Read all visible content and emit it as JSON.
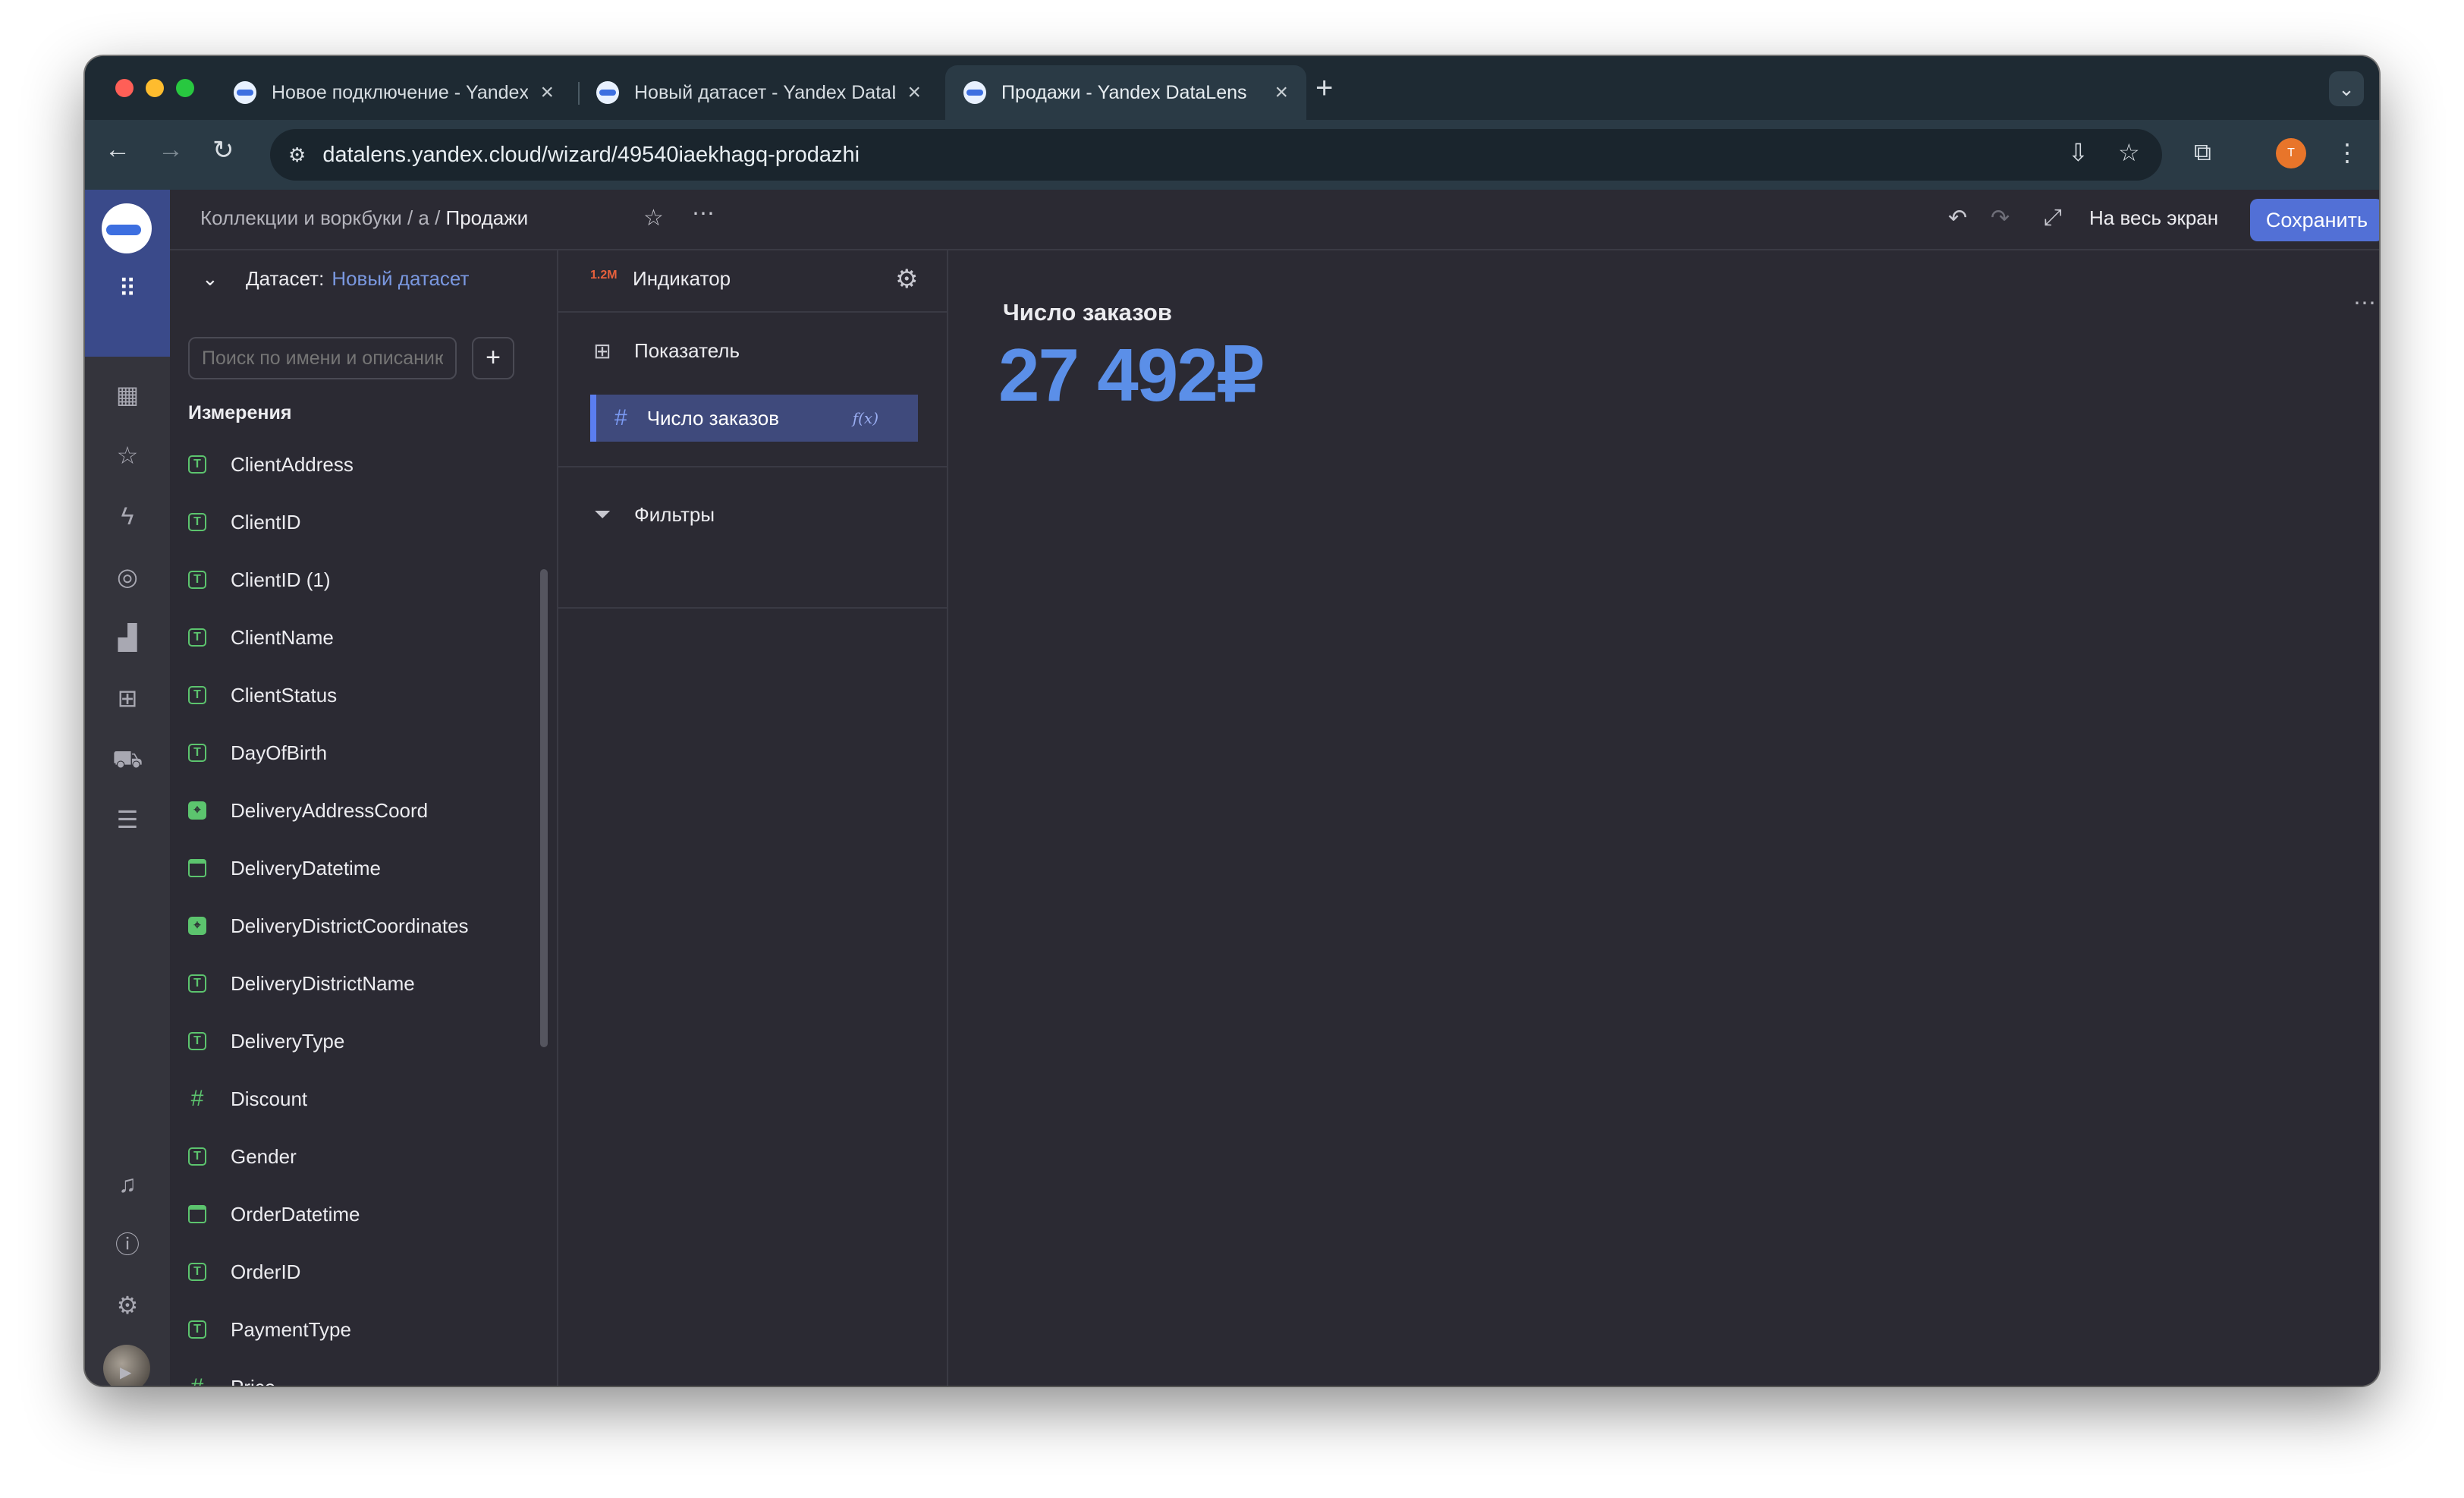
{
  "browser": {
    "tabs": [
      {
        "title": "Новое подключение - Yandex DataLens",
        "active": false
      },
      {
        "title": "Новый датасет - Yandex DataLens",
        "active": false
      },
      {
        "title": "Продажи - Yandex DataLens",
        "active": true
      }
    ],
    "url": "datalens.yandex.cloud/wizard/49540iaekhagq-prodazhi",
    "profile_initial": "T"
  },
  "header": {
    "breadcrumb_path": "Коллекции и воркбуки / а / ",
    "breadcrumb_current": "Продажи",
    "fullscreen_label": "На весь экран",
    "save_label": "Сохранить"
  },
  "dataset": {
    "label": "Датасет:",
    "name": "Новый датасет",
    "search_placeholder": "Поиск по имени и описанию",
    "dimensions_title": "Измерения",
    "fields": [
      {
        "name": "ClientAddress",
        "type": "text"
      },
      {
        "name": "ClientID",
        "type": "text"
      },
      {
        "name": "ClientID (1)",
        "type": "text"
      },
      {
        "name": "ClientName",
        "type": "text"
      },
      {
        "name": "ClientStatus",
        "type": "text"
      },
      {
        "name": "DayOfBirth",
        "type": "text"
      },
      {
        "name": "DeliveryAddressCoord",
        "type": "geo"
      },
      {
        "name": "DeliveryDatetime",
        "type": "date"
      },
      {
        "name": "DeliveryDistrictCoordinates",
        "type": "geo"
      },
      {
        "name": "DeliveryDistrictName",
        "type": "text"
      },
      {
        "name": "DeliveryType",
        "type": "text"
      },
      {
        "name": "Discount",
        "type": "number"
      },
      {
        "name": "Gender",
        "type": "text"
      },
      {
        "name": "OrderDatetime",
        "type": "date"
      },
      {
        "name": "OrderID",
        "type": "text"
      },
      {
        "name": "PaymentType",
        "type": "text"
      },
      {
        "name": "Price",
        "type": "number"
      }
    ]
  },
  "visualization": {
    "type_badge": "1.2M",
    "type_label": "Индикатор",
    "measure_section": "Показатель",
    "measure_field": "Число заказов",
    "formula_badge": "f(x)",
    "filters_section": "Фильтры"
  },
  "indicator": {
    "title": "Число заказов",
    "value": "27 492₽",
    "value_color": "#5b8fe8"
  },
  "colors": {
    "accent": "#5270d6",
    "dimension_icon": "#5cc46e"
  }
}
